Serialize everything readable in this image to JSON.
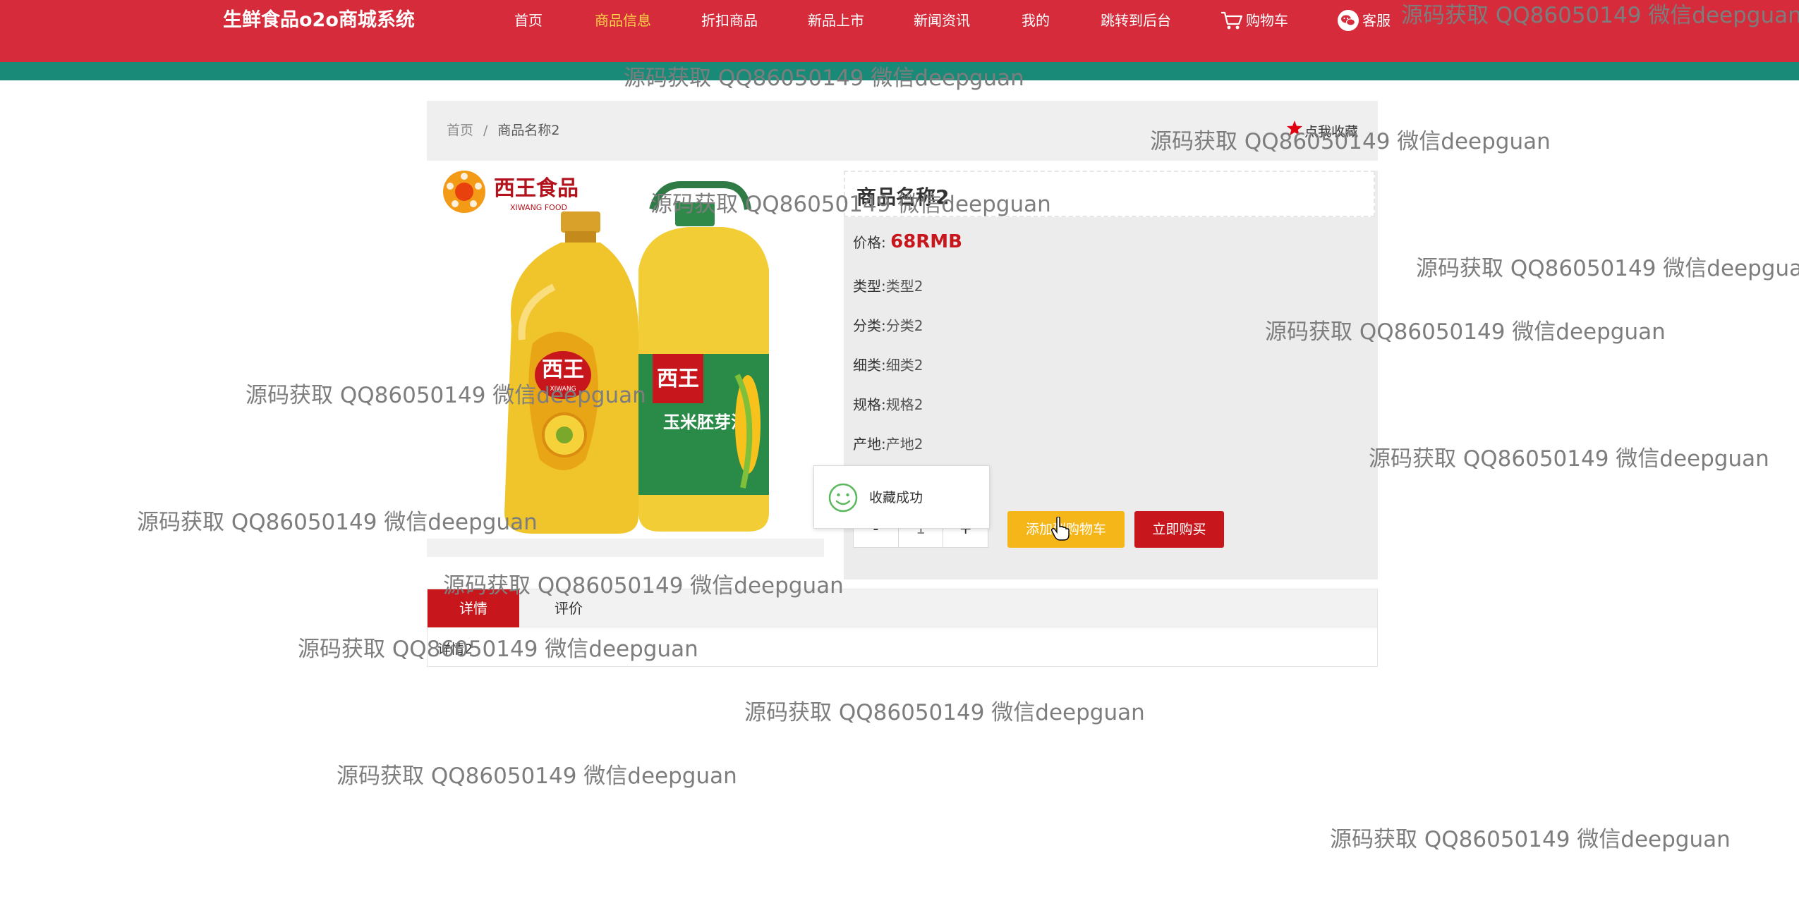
{
  "nav": {
    "brand": "生鲜食品o2o商城系统",
    "items": [
      {
        "label": "首页",
        "active": false
      },
      {
        "label": "商品信息",
        "active": true
      },
      {
        "label": "折扣商品",
        "active": false
      },
      {
        "label": "新品上市",
        "active": false
      },
      {
        "label": "新闻资讯",
        "active": false
      },
      {
        "label": "我的",
        "active": false
      },
      {
        "label": "跳转到后台",
        "active": false
      }
    ],
    "cart_label": "购物车",
    "service_label": "客服",
    "colors": {
      "bar": "#d52b3a",
      "accent_bar": "#1a8a78",
      "active_text": "#ffd54a"
    }
  },
  "watermark_text": "源码获取 QQ86050149 微信deepguan",
  "breadcrumb": {
    "home": "首页",
    "separator": "/",
    "current": "商品名称2"
  },
  "favorite_label": "点我收藏",
  "product": {
    "name": "商品名称2",
    "price_label": "价格:",
    "price_value": "68RMB",
    "fields": [
      {
        "label": "类型:",
        "value": "类型2"
      },
      {
        "label": "分类:",
        "value": "分类2"
      },
      {
        "label": "细类:",
        "value": "细类2"
      },
      {
        "label": "规格:",
        "value": "规格2"
      },
      {
        "label": "产地:",
        "value": "产地2"
      }
    ],
    "image_brand": "西王食品",
    "image_brand_en": "XIWANG FOOD"
  },
  "quantity": {
    "minus": "-",
    "value": "1",
    "plus": "+"
  },
  "buttons": {
    "add_to_cart": "添加到购物车",
    "buy_now": "立即购买"
  },
  "toast": {
    "message": "收藏成功"
  },
  "tabs": {
    "detail": "详情",
    "review": "评价"
  },
  "detail_content": "详情2",
  "icons": [
    "cart-icon",
    "wechat-icon",
    "star-icon",
    "smile-icon",
    "hand-cursor-icon"
  ]
}
